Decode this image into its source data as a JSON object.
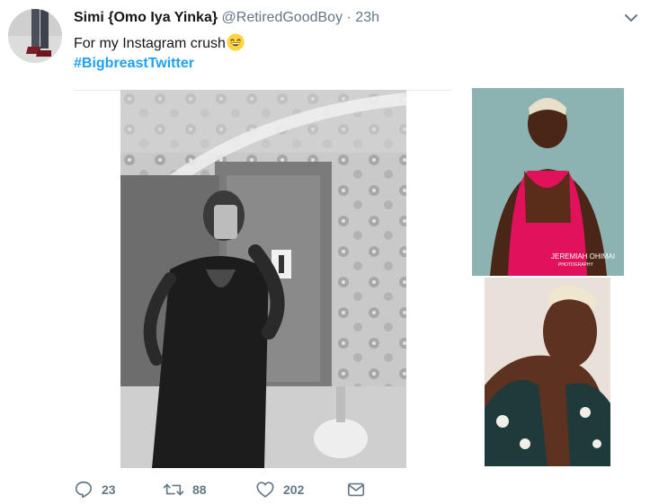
{
  "tweet": {
    "display_name": "Simi {Omo Iya Yinka}",
    "handle": "@RetiredGoodBoy",
    "separator": "·",
    "timestamp": "23h",
    "text": "For my Instagram crush",
    "emoji": "grinning-face-with-smiling-eyes",
    "hashtag": "#BigbreastTwitter"
  },
  "media": {
    "photo_2_watermark_line1": "JEREMIAH OHIMAI",
    "photo_2_watermark_line2": "PHOTOGRAPHY"
  },
  "actions": {
    "reply_count": "23",
    "retweet_count": "88",
    "like_count": "202"
  },
  "colors": {
    "accent": "#1da1f2",
    "text": "#14171a",
    "muted": "#657786"
  }
}
